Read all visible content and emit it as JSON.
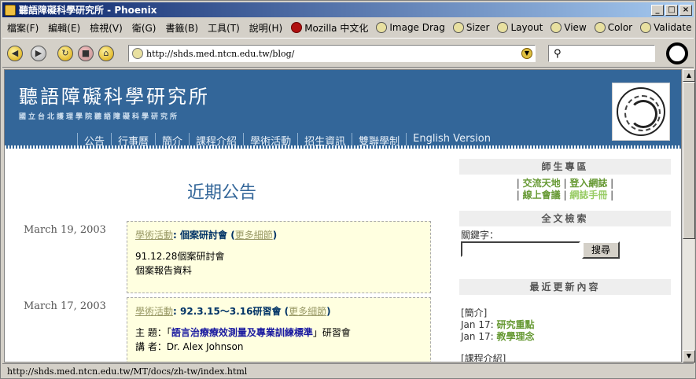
{
  "window": {
    "title": "聽語障礙科學研究所 - Phoenix",
    "min": "_",
    "max": "□",
    "close": "×"
  },
  "menu": {
    "items": [
      "檔案(F)",
      "編輯(E)",
      "檢視(V)",
      "衛(G)",
      "書籤(B)",
      "工具(T)",
      "說明(H)"
    ],
    "ext": [
      "Mozilla 中文化",
      "Image Drag",
      "Sizer",
      "Layout",
      "View",
      "Color",
      "Validate"
    ]
  },
  "toolbar": {
    "url": "http://shds.med.ntcn.edu.tw/blog/",
    "search_glyph": "⚲"
  },
  "site": {
    "title": "聽語障礙科學研究所",
    "subtitle": "國立台北護理學院聽語障礙科學研究所",
    "nav": [
      "公告",
      "行事曆",
      "簡介",
      "課程介紹",
      "學術活動",
      "招生資訊",
      "雙聯學制",
      "English Version"
    ]
  },
  "main": {
    "title": "近期公告",
    "entries": [
      {
        "date": "March 19, 2003",
        "category": "學術活動",
        "title": "個案研討會",
        "more": "更多細節",
        "lines": [
          "91.12.28個案研討會",
          "個案報告資料"
        ]
      },
      {
        "date": "March 17, 2003",
        "category": "學術活動",
        "title": "92.3.15～3.16研習會",
        "more": "更多細節",
        "theme_prefix": "主 題：「",
        "theme_hl": "語言治療療效測量及專業訓練標準",
        "theme_suffix": "」研習會",
        "speaker": "講 者：Dr. Alex Johnson"
      }
    ]
  },
  "sidebar": {
    "section1": "師生專區",
    "links1a": [
      "交流天地",
      "登入網誌"
    ],
    "links1b": [
      "線上會議",
      "網誌手冊"
    ],
    "section2": "全文檢索",
    "kw_label": "關鍵字：",
    "search_button": "搜尋",
    "section3": "最近更新內容",
    "recent": [
      {
        "group": "[簡介]"
      },
      {
        "date": "Jan 17:",
        "link": "研究重點"
      },
      {
        "date": "Jan 17:",
        "link": "教學理念"
      },
      {
        "group": "[課程介紹]"
      }
    ]
  },
  "status": {
    "text": "http://shds.med.ntcn.edu.tw/MT/docs/zh-tw/index.html"
  }
}
